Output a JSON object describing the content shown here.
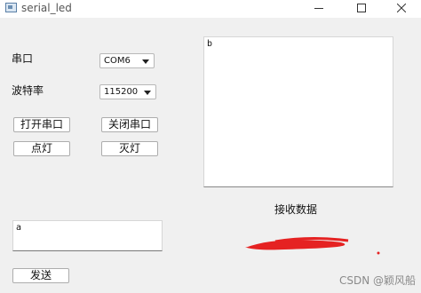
{
  "window": {
    "title": "serial_led"
  },
  "labels": {
    "port": "串口",
    "baud": "波特率",
    "receive": "接收数据"
  },
  "port_select": {
    "value": "COM6"
  },
  "baud_select": {
    "value": "115200"
  },
  "buttons": {
    "open": "打开串口",
    "close": "关闭串口",
    "led_on": "点灯",
    "led_off": "灭灯",
    "send": "发送"
  },
  "receive_box": {
    "text": "b"
  },
  "send_box": {
    "text": "a"
  },
  "watermark": "CSDN @颖风船"
}
